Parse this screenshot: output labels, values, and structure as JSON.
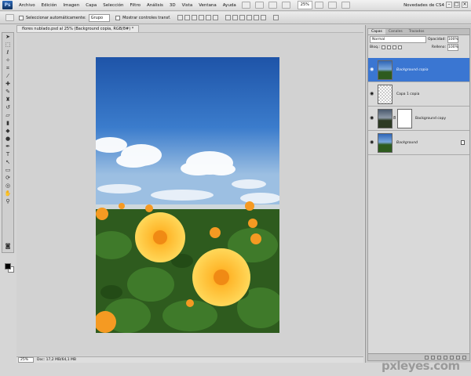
{
  "menu": {
    "logo": "Ps",
    "items": [
      "Archivo",
      "Edición",
      "Imagen",
      "Capa",
      "Selección",
      "Filtro",
      "Análisis",
      "3D",
      "Vista",
      "Ventana",
      "Ayuda"
    ],
    "zoom": "25%",
    "workspace": "Novedades de CS4"
  },
  "options": {
    "auto_select_label": "Seleccionar automáticamente:",
    "auto_select_value": "Grupo",
    "transform_label": "Mostrar controles transf."
  },
  "document": {
    "tab_title": "flores nublado.psd al 25% (Background copia, RGB/8#) *",
    "status_zoom": "25%",
    "status_doc": "Doc: 17,2 MB/64,1 MB"
  },
  "layers_panel": {
    "tabs": [
      "Capas",
      "Canales",
      "Trazados"
    ],
    "blend_mode": "Normal",
    "opacity_label": "Opacidad:",
    "opacity_value": "100%",
    "lock_label": "Bloq.:",
    "fill_label": "Relleno:",
    "fill_value": "100%",
    "layers": [
      {
        "name": "Background copia",
        "selected": true,
        "thumb": "photo"
      },
      {
        "name": "Capa 1 copia",
        "selected": false,
        "thumb": "transparent"
      },
      {
        "name": "Background copy",
        "selected": false,
        "thumb": "photo-dark",
        "mask": true
      },
      {
        "name": "Background",
        "selected": false,
        "thumb": "photo",
        "locked": true
      }
    ]
  },
  "watermark": "pxleyes.com"
}
